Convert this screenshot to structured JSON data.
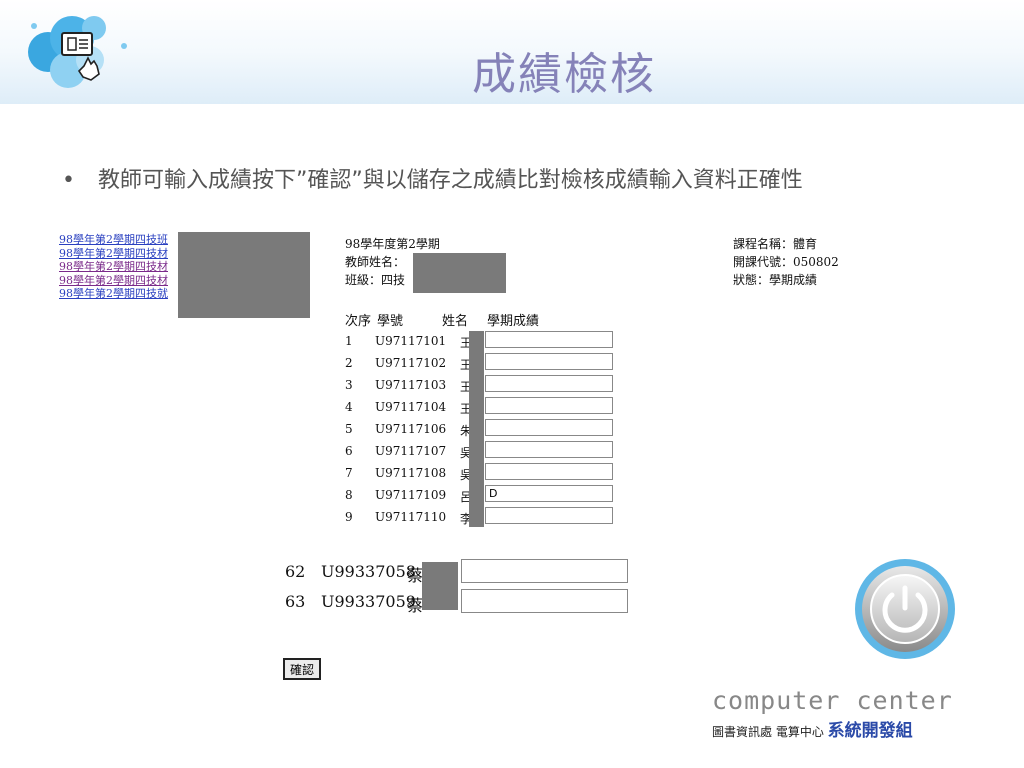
{
  "slide": {
    "title": "成績檢核",
    "bullet": "教師可輸入成績按下”確認”與以儲存之成績比對檢核成績輸入資料正確性"
  },
  "course_links": [
    "98學年第2學期四技班",
    "98學年第2學期四技材",
    "98學年第2學期四技材",
    "98學年第2學期四技材",
    "98學年第2學期四技就"
  ],
  "form_header": {
    "semester": "98學年度第2學期",
    "teacher": "教師姓名：",
    "class": "班級：四技",
    "course_name": "課程名稱：體育",
    "course_code": "開課代號：050802",
    "status": "狀態：學期成績"
  },
  "table": {
    "columns": [
      "次序",
      "學號",
      "姓名",
      "學期成績"
    ],
    "rows": [
      {
        "no": "1",
        "id": "U97117101",
        "name": "王",
        "grade": ""
      },
      {
        "no": "2",
        "id": "U97117102",
        "name": "王",
        "grade": ""
      },
      {
        "no": "3",
        "id": "U97117103",
        "name": "王",
        "grade": ""
      },
      {
        "no": "4",
        "id": "U97117104",
        "name": "王",
        "grade": ""
      },
      {
        "no": "5",
        "id": "U97117106",
        "name": "朱",
        "grade": ""
      },
      {
        "no": "6",
        "id": "U97117107",
        "name": "吳",
        "grade": ""
      },
      {
        "no": "7",
        "id": "U97117108",
        "name": "吳",
        "grade": ""
      },
      {
        "no": "8",
        "id": "U97117109",
        "name": "呂",
        "grade": "D"
      },
      {
        "no": "9",
        "id": "U97117110",
        "name": "李",
        "grade": ""
      }
    ],
    "bottom_rows": [
      {
        "no": "62",
        "id": "U99337058",
        "name": "蔡",
        "grade": ""
      },
      {
        "no": "63",
        "id": "U99337059",
        "name": "蔡",
        "grade": ""
      }
    ]
  },
  "confirm_label": "確認",
  "branding": {
    "computer_center": "computer center",
    "dept_small": "圖書資訊處 電算中心",
    "dept_big": "系統開發組"
  },
  "icons": {
    "logo": "id-card-hand-cursor-icon",
    "power": "power-button-icon"
  },
  "colors": {
    "title": "#8582b8",
    "link": "#2a40c0",
    "link_visited": "#7a2a8a",
    "dept_accent": "#2b4aa8"
  }
}
